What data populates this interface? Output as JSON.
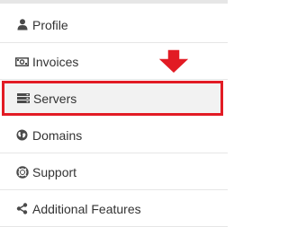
{
  "menu": {
    "items": [
      {
        "label": "Profile",
        "icon": "user-icon"
      },
      {
        "label": "Invoices",
        "icon": "money-bill-icon"
      },
      {
        "label": "Servers",
        "icon": "server-icon"
      },
      {
        "label": "Domains",
        "icon": "globe-icon"
      },
      {
        "label": "Support",
        "icon": "life-ring-icon"
      },
      {
        "label": "Additional Features",
        "icon": "share-nodes-icon"
      }
    ],
    "selected": "Servers"
  },
  "colors": {
    "highlight_border": "#e21b24",
    "arrow": "#e21b24",
    "text": "#333333",
    "divider": "#e6e6e6",
    "selected_background": "#f2f2f2"
  }
}
